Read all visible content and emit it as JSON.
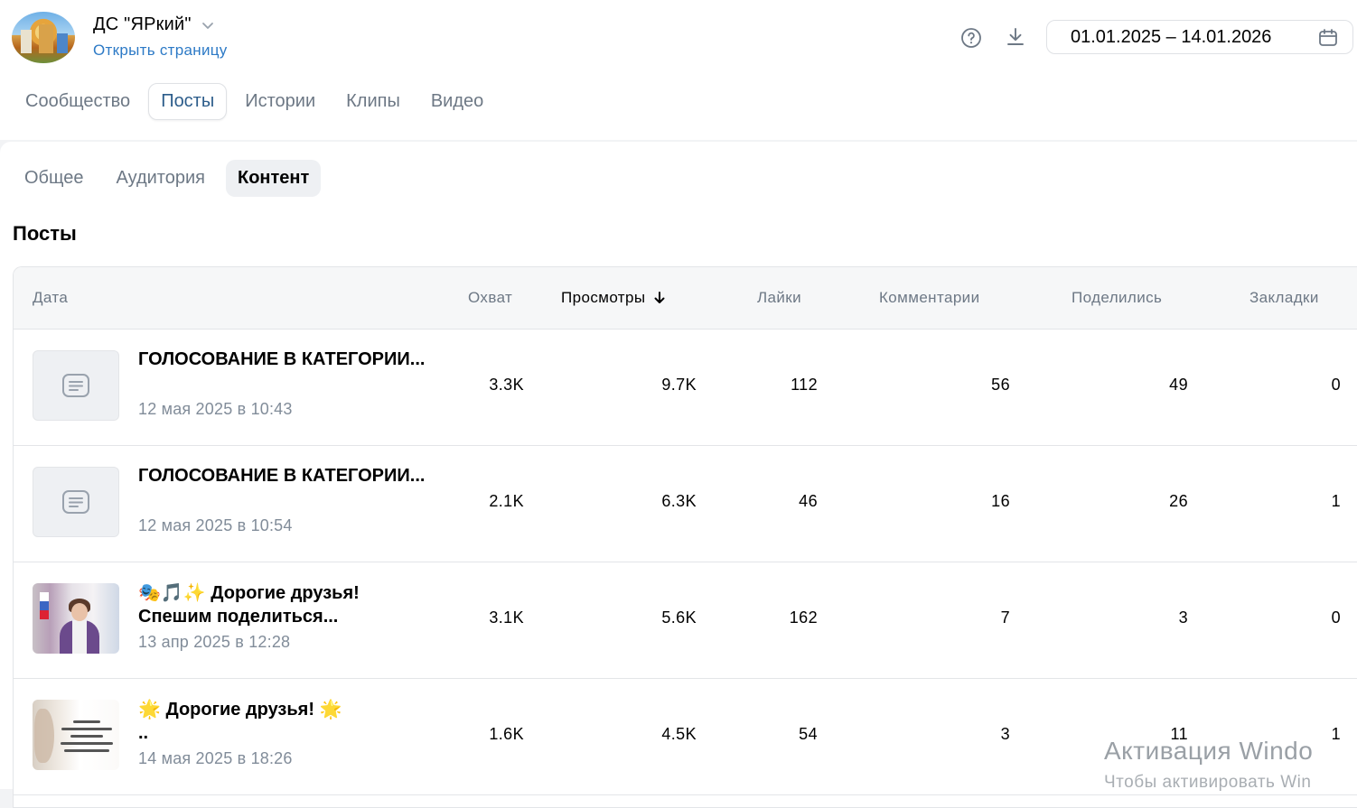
{
  "header": {
    "community_name": "ДС \"ЯРкий\"",
    "open_page_link": "Открыть страницу",
    "date_range": "01.01.2025 – 14.01.2026"
  },
  "tabs": [
    {
      "label": "Сообщество",
      "active": false
    },
    {
      "label": "Посты",
      "active": true
    },
    {
      "label": "Истории",
      "active": false
    },
    {
      "label": "Клипы",
      "active": false
    },
    {
      "label": "Видео",
      "active": false
    }
  ],
  "subtabs": [
    {
      "label": "Общее",
      "active": false
    },
    {
      "label": "Аудитория",
      "active": false
    },
    {
      "label": "Контент",
      "active": true
    }
  ],
  "section_title": "Посты",
  "table": {
    "columns": {
      "date": "Дата",
      "reach": "Охват",
      "views": "Просмотры",
      "likes": "Лайки",
      "comments": "Комментарии",
      "shares": "Поделились",
      "bookmarks": "Закладки"
    },
    "sorted_by": "views",
    "rows": [
      {
        "title": "ГОЛОСОВАНИЕ В КАТЕГОРИИ...",
        "date": "12 мая 2025 в 10:43",
        "reach": "3.3K",
        "views": "9.7K",
        "likes": "112",
        "comments": "56",
        "shares": "49",
        "bookmarks": "0",
        "thumb": "post-icon"
      },
      {
        "title": "ГОЛОСОВАНИЕ В КАТЕГОРИИ...",
        "date": "12 мая 2025 в 10:54",
        "reach": "2.1K",
        "views": "6.3K",
        "likes": "46",
        "comments": "16",
        "shares": "26",
        "bookmarks": "1",
        "thumb": "post-icon"
      },
      {
        "title_emoji": "🎭🎵✨",
        "title": "Дорогие друзья! Спешим поделиться...",
        "date": "13 апр 2025 в 12:28",
        "reach": "3.1K",
        "views": "5.6K",
        "likes": "162",
        "comments": "7",
        "shares": "3",
        "bookmarks": "0",
        "thumb": "photo"
      },
      {
        "title_emoji": "🌟",
        "title": "Дорогие друзья!",
        "title_emoji_end": "🌟",
        "title_line2": "..",
        "date": "14 мая 2025 в 18:26",
        "reach": "1.6K",
        "views": "4.5K",
        "likes": "54",
        "comments": "3",
        "shares": "11",
        "bookmarks": "1",
        "thumb": "poster"
      }
    ]
  },
  "watermark": {
    "line1": "Активация Windo",
    "line2": "Чтобы активировать Win"
  }
}
